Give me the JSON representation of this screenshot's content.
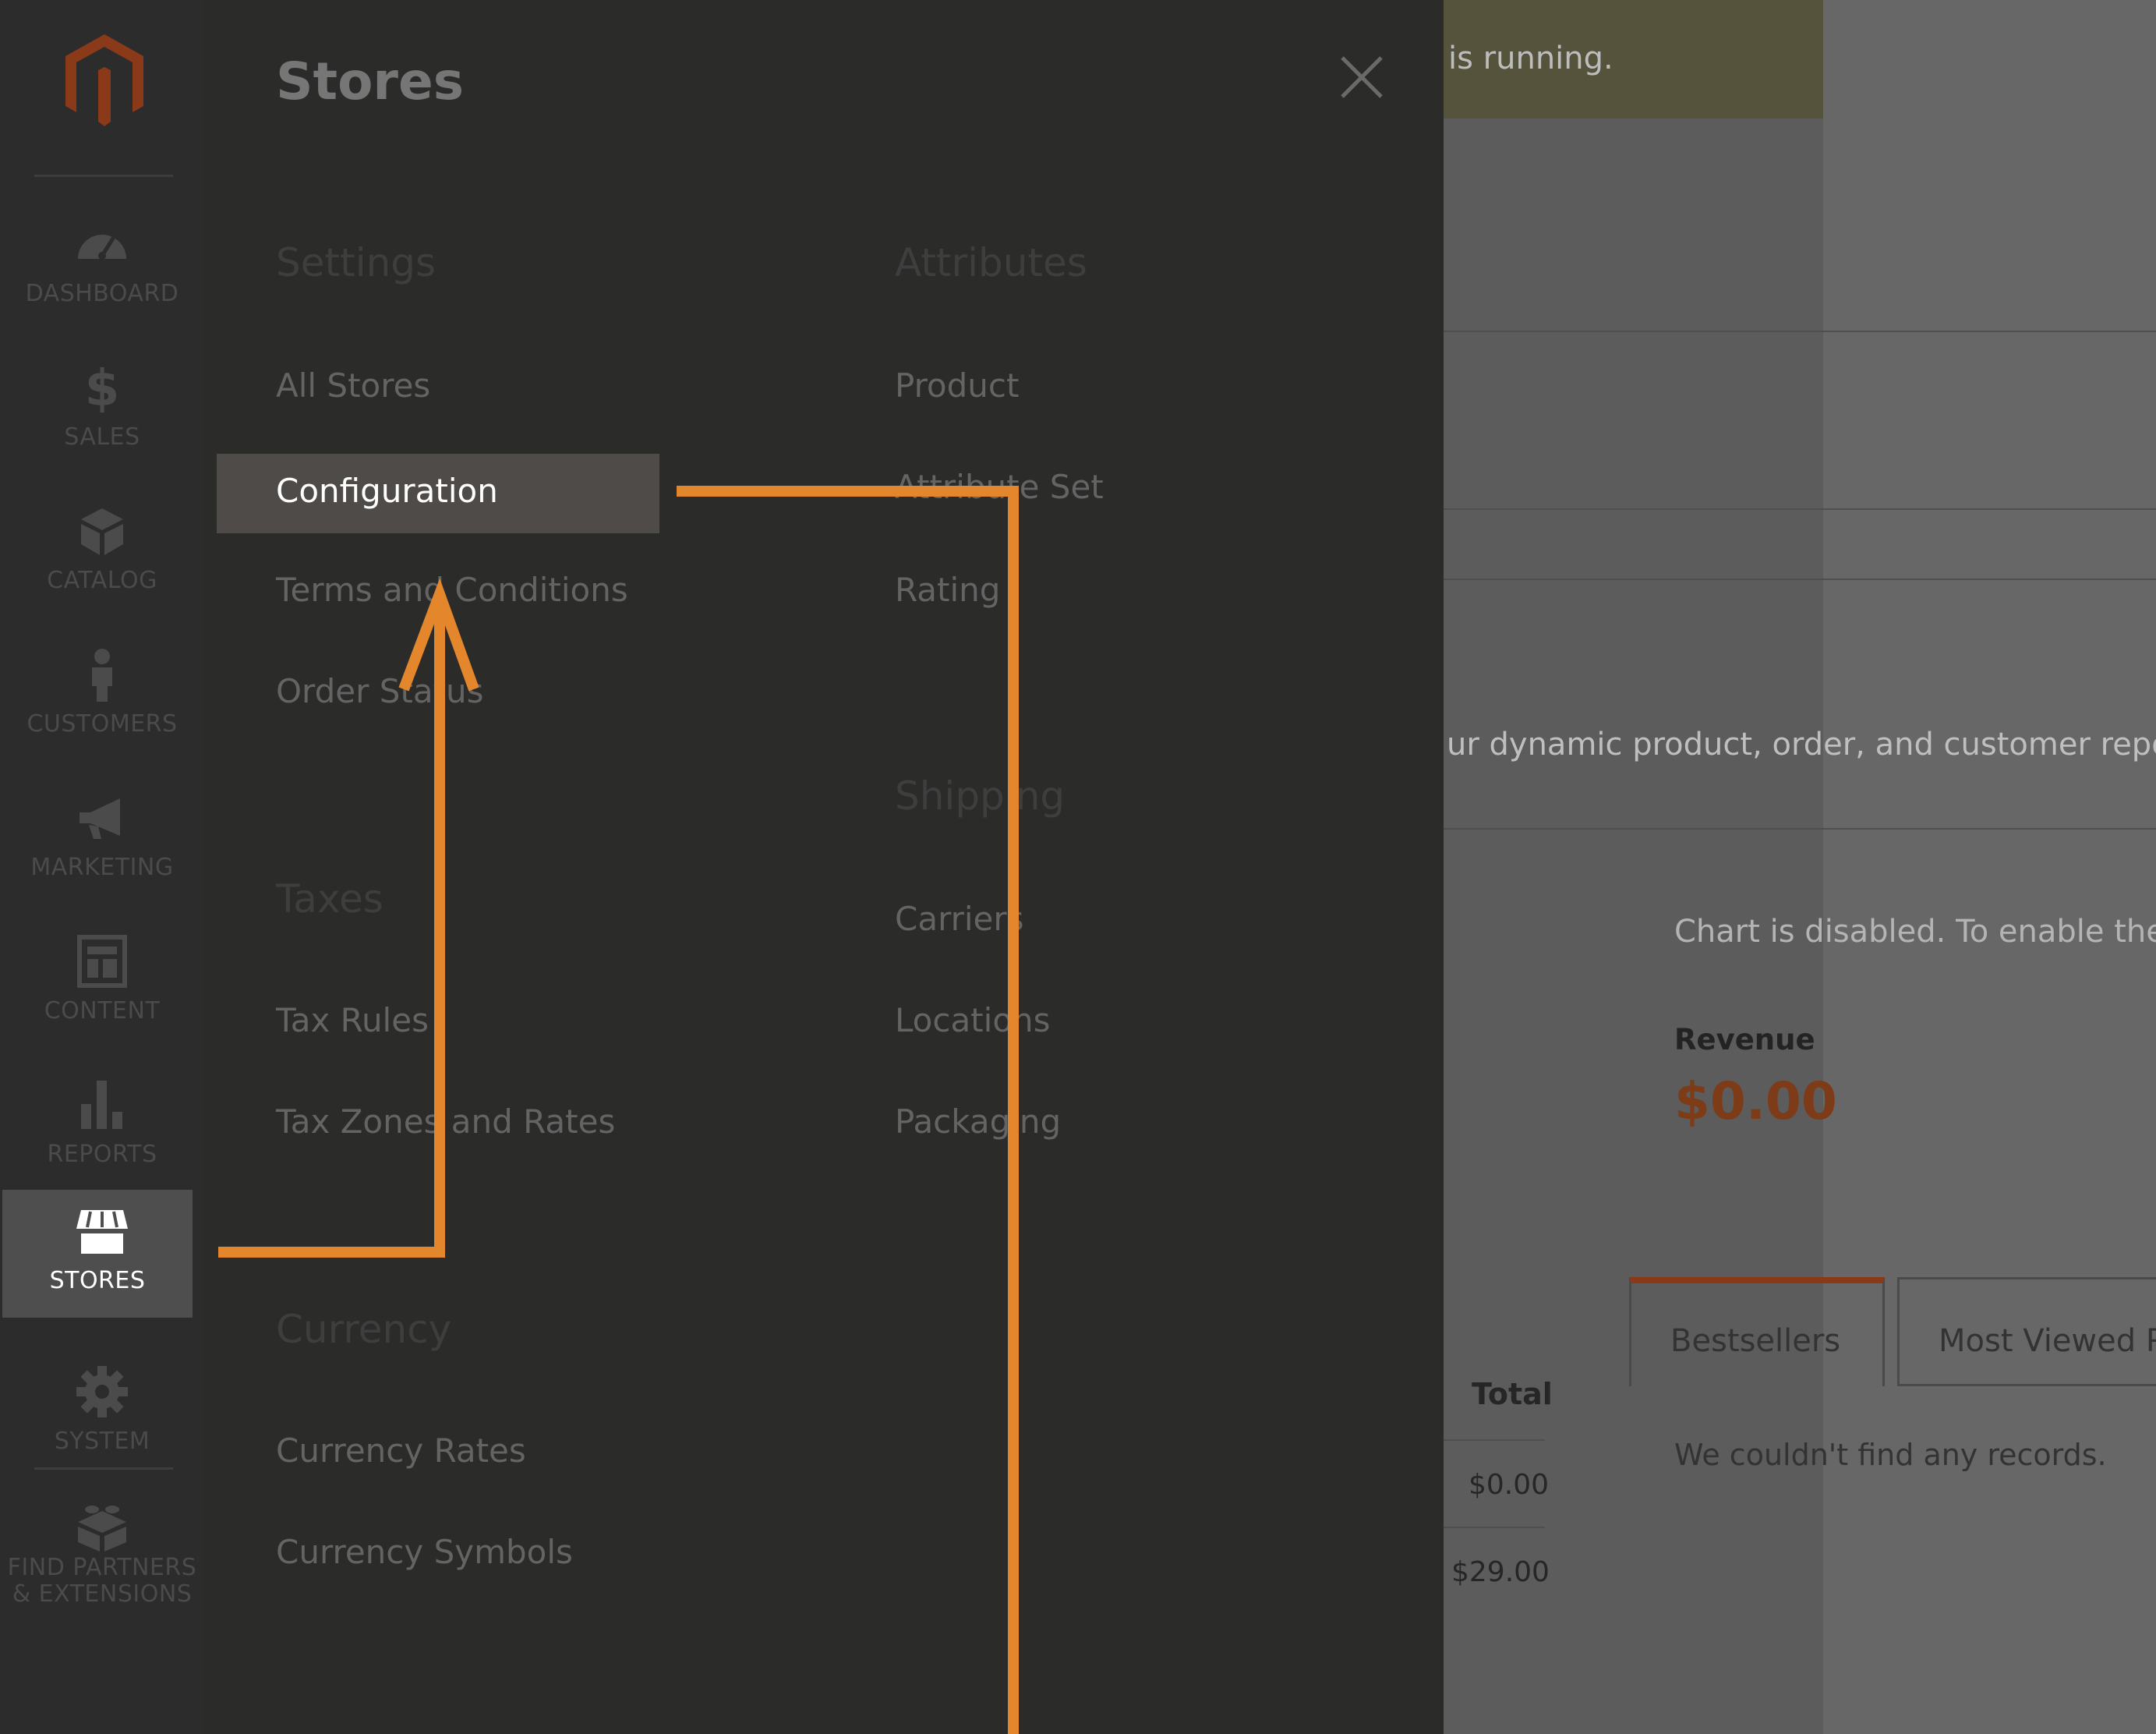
{
  "background": {
    "banner_text": "is running.",
    "intro_text": "ur dynamic product, order, and customer report",
    "chart_note": "Chart is disabled. To enable the",
    "revenue": {
      "label": "Revenue",
      "value": "$0.00"
    },
    "tabs": [
      {
        "label": "Bestsellers",
        "active": true
      },
      {
        "label": "Most Viewed P",
        "active": false
      }
    ],
    "tab_empty_message": "We couldn't find any records.",
    "table": {
      "header_total": "Total",
      "rows": [
        {
          "total": "$0.00"
        },
        {
          "total": "$29.00"
        }
      ]
    }
  },
  "nav": {
    "items": [
      {
        "id": "dashboard",
        "label": "DASHBOARD",
        "icon": "dashboard-icon"
      },
      {
        "id": "sales",
        "label": "SALES",
        "icon": "dollar-icon"
      },
      {
        "id": "catalog",
        "label": "CATALOG",
        "icon": "box-icon"
      },
      {
        "id": "customers",
        "label": "CUSTOMERS",
        "icon": "person-icon"
      },
      {
        "id": "marketing",
        "label": "MARKETING",
        "icon": "megaphone-icon"
      },
      {
        "id": "content",
        "label": "CONTENT",
        "icon": "layout-icon"
      },
      {
        "id": "reports",
        "label": "REPORTS",
        "icon": "bar-chart-icon"
      },
      {
        "id": "stores",
        "label": "STORES",
        "icon": "storefront-icon",
        "active": true
      },
      {
        "id": "system",
        "label": "SYSTEM",
        "icon": "gear-icon"
      }
    ],
    "partners": {
      "label_line1": "FIND PARTNERS",
      "label_line2": "& EXTENSIONS",
      "icon": "lego-brick-icon"
    }
  },
  "flyout": {
    "title": "Stores",
    "groups": {
      "settings": {
        "title": "Settings",
        "links": [
          "All Stores",
          "Configuration",
          "Terms and Conditions",
          "Order Status"
        ],
        "selected": "Configuration"
      },
      "taxes": {
        "title": "Taxes",
        "links": [
          "Tax Rules",
          "Tax Zones and Rates"
        ]
      },
      "currency": {
        "title": "Currency",
        "links": [
          "Currency Rates",
          "Currency Symbols"
        ]
      },
      "attributes": {
        "title": "Attributes",
        "links": [
          "Product",
          "Attribute Set",
          "Rating"
        ]
      },
      "shipping": {
        "title": "Shipping",
        "links": [
          "Carriers",
          "Locations",
          "Packaging"
        ]
      }
    }
  },
  "colors": {
    "accent_orange": "#e4862c",
    "brand_logo": "#8a3a18",
    "nav_background": "#2c2c2c",
    "flyout_background": "#2b2b2a",
    "selected_item": "#4e4b49"
  }
}
